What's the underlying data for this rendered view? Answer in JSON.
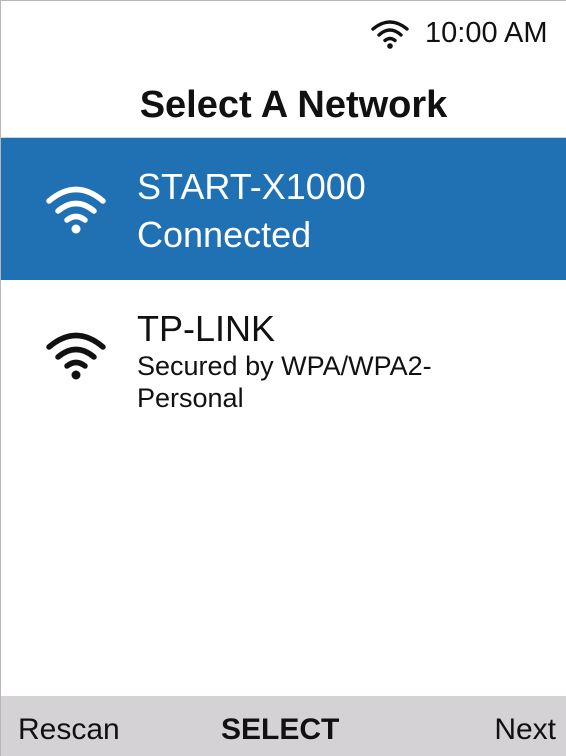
{
  "status_bar": {
    "wifi_icon": "wifi-icon",
    "time": "10:00 AM"
  },
  "page": {
    "title": "Select A Network"
  },
  "networks": [
    {
      "ssid": "START-X1000",
      "detail": "Connected",
      "icon": "wifi-icon",
      "selected": true
    },
    {
      "ssid": "TP-LINK",
      "detail": "Secured by WPA/WPA2-Personal",
      "icon": "wifi-icon",
      "selected": false
    }
  ],
  "softkeys": {
    "left": "Rescan",
    "center": "SELECT",
    "right": "Next"
  },
  "colors": {
    "selected_background": "#2070b4",
    "bottom_bar_background": "#d5d2d5"
  }
}
